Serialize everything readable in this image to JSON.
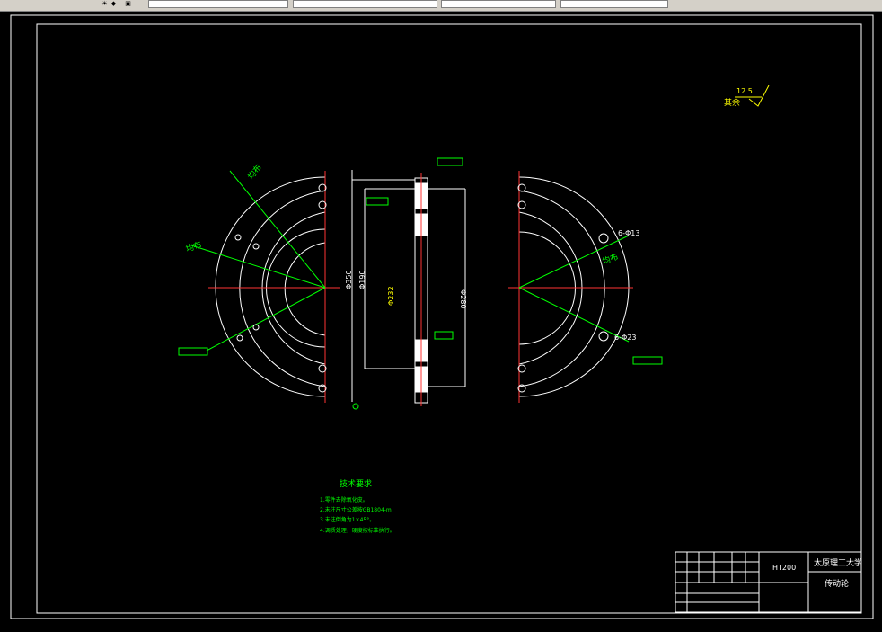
{
  "toolbar": {
    "seg1": "",
    "seg2": "",
    "seg3": "",
    "seg4": "",
    "seg5": ""
  },
  "drawing": {
    "roughness_label": "其余",
    "roughness_value": "12.5",
    "tech_req_title": "技术要求",
    "tech_req_items": [
      "1.零件去除氧化皮。",
      "2.未注尺寸公差按GB1804-m",
      "3.未注倒角为1×45°。",
      "4.调质处理，硬度按标准执行。"
    ],
    "left_labels": {
      "a": "均布",
      "b": "均布"
    },
    "right_labels": {
      "a": "均布",
      "b": "6-Φ13",
      "c": "6-Φ23"
    },
    "mid_dims": {
      "d1": "Φ350",
      "d2": "Φ190",
      "d3": "Φ232",
      "d4": "Φ280"
    },
    "title_block": {
      "material": "HT200",
      "school": "太原理工大学",
      "part_name": "传动轮"
    },
    "colors": {
      "red": "#ff3333",
      "white": "#ffffff",
      "green": "#00ff00",
      "yellow": "#ffff00"
    }
  }
}
